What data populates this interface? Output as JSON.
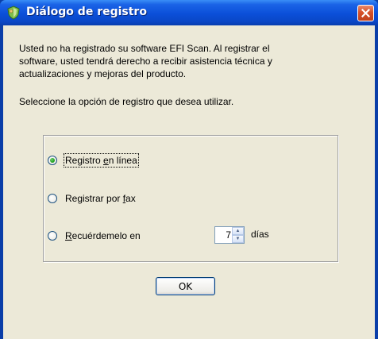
{
  "window": {
    "title": "Diálogo de registro",
    "icon": "registration-shield-icon",
    "close_icon": "close-icon"
  },
  "body": {
    "intro_line1": "Usted no ha registrado su software EFI Scan.  Al registrar el",
    "intro_line2": "software, usted tendrá derecho a recibir asistencia técnica y",
    "intro_line3": "actualizaciones y mejoras del producto.",
    "instruction": "Seleccione la opción de registro que desea utilizar."
  },
  "options": {
    "online": {
      "before": "Registro ",
      "accel": "e",
      "after": "n línea",
      "selected": true
    },
    "fax": {
      "before": "Registrar por ",
      "accel": "f",
      "after": "ax",
      "selected": false
    },
    "remind": {
      "before": "",
      "accel": "R",
      "after": "ecuérdemelo en",
      "selected": false
    }
  },
  "reminder": {
    "days_value": "7",
    "days_label": "días"
  },
  "buttons": {
    "ok": "OK"
  },
  "colors": {
    "titlebar": "#0b4fd9",
    "client": "#ece9d8",
    "close": "#d6512a"
  }
}
